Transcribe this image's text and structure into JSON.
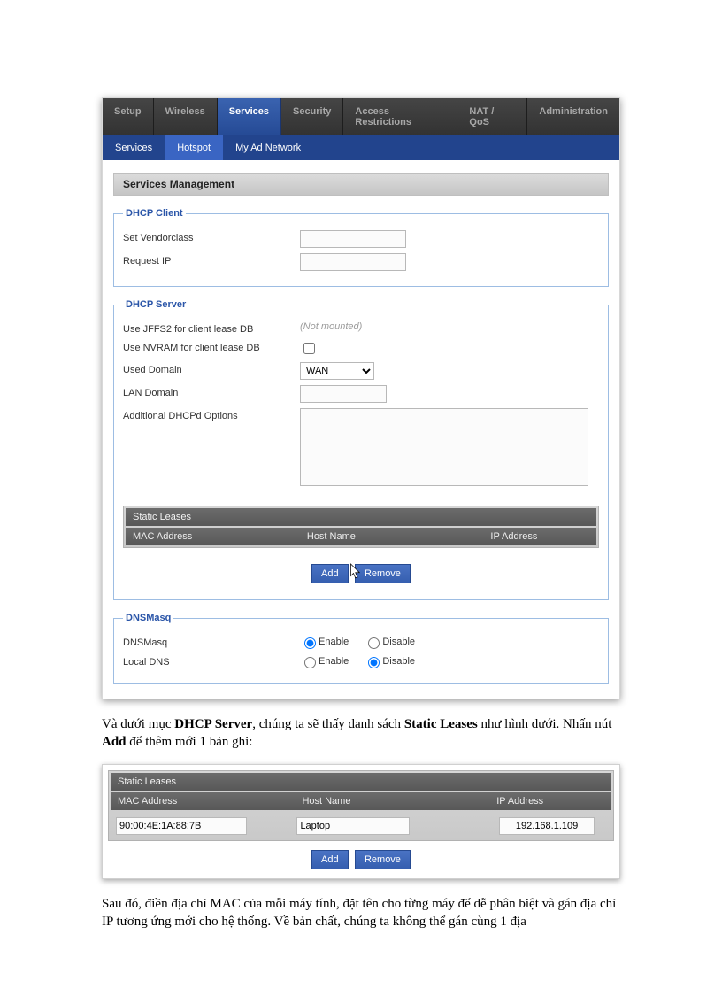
{
  "main_nav": {
    "tabs": [
      "Setup",
      "Wireless",
      "Services",
      "Security",
      "Access Restrictions",
      "NAT / QoS",
      "Administration"
    ],
    "active_index": 2
  },
  "sub_nav": {
    "tabs": [
      "Services",
      "Hotspot",
      "My Ad Network"
    ],
    "active_index": 1
  },
  "section_title": "Services Management",
  "dhcp_client": {
    "legend": "DHCP Client",
    "set_vendorclass_label": "Set Vendorclass",
    "set_vendorclass_value": "",
    "request_ip_label": "Request IP",
    "request_ip_value": ""
  },
  "dhcp_server": {
    "legend": "DHCP Server",
    "jffs2_label": "Use JFFS2 for client lease DB",
    "jffs2_status": "(Not mounted)",
    "nvram_label": "Use NVRAM for client lease DB",
    "nvram_checked": false,
    "used_domain_label": "Used Domain",
    "used_domain_value": "WAN",
    "lan_domain_label": "LAN Domain",
    "lan_domain_value": "",
    "additional_opts_label": "Additional DHCPd Options",
    "additional_opts_value": "",
    "static_leases_title": "Static Leases",
    "col_mac": "MAC Address",
    "col_host": "Host Name",
    "col_ip": "IP Address",
    "add_label": "Add",
    "remove_label": "Remove"
  },
  "dnsmasq": {
    "legend": "DNSMasq",
    "dnsmasq_label": "DNSMasq",
    "local_dns_label": "Local DNS",
    "enable": "Enable",
    "disable": "Disable",
    "dnsmasq_selected": "Enable",
    "local_dns_selected": "Disable"
  },
  "body1_part1": "Và dưới mục ",
  "body1_bold1": "DHCP Server",
  "body1_part2": ", chúng ta sẽ thấy danh sách ",
  "body1_bold2": "Static Leases",
  "body1_part3": " như hình dưới. Nhấn nút ",
  "body1_bold3": "Add",
  "body1_part4": " để thêm mới 1 bản ghi:",
  "second_leases": {
    "title": "Static Leases",
    "col_mac": "MAC Address",
    "col_host": "Host Name",
    "col_ip": "IP Address",
    "row_mac": "90:00:4E:1A:88:7B",
    "row_host": "Laptop",
    "row_ip": "192.168.1.109",
    "add_label": "Add",
    "remove_label": "Remove"
  },
  "body2": "Sau đó, điền địa chỉ MAC của mỗi máy tính, đặt tên cho từng máy để dễ phân biệt và gán địa chỉ IP tương ứng mới cho hệ thống. Về bản chất, chúng ta không thể gán cùng 1 địa"
}
